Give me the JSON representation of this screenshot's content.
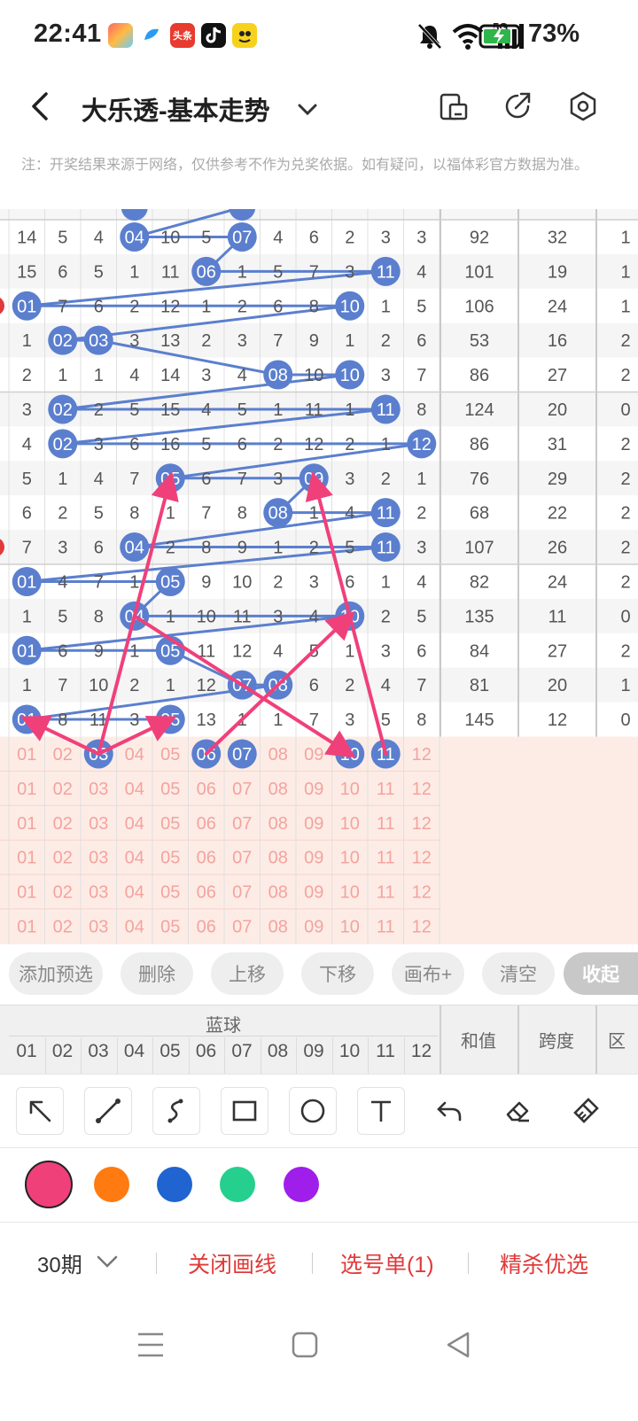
{
  "status_bar": {
    "time": "22:41",
    "battery": "73%",
    "network": "5G",
    "app_icons": [
      "photos-app-icon",
      "browser-app-icon",
      "toutiao-app-icon",
      "tiktok-app-icon",
      "game-app-icon"
    ],
    "toutiao_label": "头条",
    "status_icons": [
      "mute-icon",
      "wifi-icon",
      "signal-icon",
      "battery-icon"
    ]
  },
  "header": {
    "title": "大乐透-基本走势",
    "icons": [
      "back-icon",
      "chevron-down-icon",
      "device-icon",
      "share-icon",
      "settings-icon"
    ]
  },
  "notice": "注：开奖结果来源于网络，仅供参考不作为兑奖依据。如有疑问，以福体彩官方数据为准。",
  "colors": {
    "ball_blue": "#5b7fce",
    "line_blue": "#5b7fce",
    "arrow_pink": "#f0407a",
    "pick_bg": "#fdece6",
    "pick_text": "#f4a39e",
    "alert_red": "#e03a3a"
  },
  "chart": {
    "rows": [
      {
        "omit": [
          "14",
          "5",
          "4",
          null,
          "10",
          "5",
          null,
          "4",
          "6",
          "2",
          "3",
          "3"
        ],
        "balls": [
          3,
          6
        ],
        "sum": "92",
        "span": "32",
        "zone": "1"
      },
      {
        "omit": [
          "15",
          "6",
          "5",
          "1",
          "11",
          null,
          "1",
          "5",
          "7",
          "3",
          null,
          "4"
        ],
        "balls": [
          5,
          10
        ],
        "sum": "101",
        "span": "19",
        "zone": "1"
      },
      {
        "omit": [
          null,
          "7",
          "6",
          "2",
          "12",
          "1",
          "2",
          "6",
          "8",
          null,
          "1",
          "5"
        ],
        "balls": [
          0,
          9
        ],
        "sum": "106",
        "span": "24",
        "zone": "1"
      },
      {
        "omit": [
          "1",
          null,
          null,
          "3",
          "13",
          "2",
          "3",
          "7",
          "9",
          "1",
          "2",
          "6"
        ],
        "balls": [
          1,
          2
        ],
        "sum": "53",
        "span": "16",
        "zone": "2"
      },
      {
        "omit": [
          "2",
          "1",
          "1",
          "4",
          "14",
          "3",
          "4",
          null,
          "10",
          null,
          "3",
          "7"
        ],
        "balls": [
          7,
          9
        ],
        "sum": "86",
        "span": "27",
        "zone": "2"
      },
      {
        "omit": [
          "3",
          null,
          "2",
          "5",
          "15",
          "4",
          "5",
          "1",
          "11",
          "1",
          null,
          "8"
        ],
        "balls": [
          1,
          10
        ],
        "sum": "124",
        "span": "20",
        "zone": "0"
      },
      {
        "omit": [
          "4",
          null,
          "3",
          "6",
          "16",
          "5",
          "6",
          "2",
          "12",
          "2",
          "1",
          null
        ],
        "balls": [
          1,
          11
        ],
        "sum": "86",
        "span": "31",
        "zone": "2"
      },
      {
        "omit": [
          "5",
          "1",
          "4",
          "7",
          null,
          "6",
          "7",
          "3",
          null,
          "3",
          "2",
          "1"
        ],
        "balls": [
          4,
          8
        ],
        "sum": "76",
        "span": "29",
        "zone": "2"
      },
      {
        "omit": [
          "6",
          "2",
          "5",
          "8",
          "1",
          "7",
          "8",
          null,
          "1",
          "4",
          null,
          "2"
        ],
        "balls": [
          7,
          10
        ],
        "sum": "68",
        "span": "22",
        "zone": "2"
      },
      {
        "omit": [
          "7",
          "3",
          "6",
          null,
          "2",
          "8",
          "9",
          "1",
          "2",
          "5",
          null,
          "3"
        ],
        "balls": [
          3,
          10
        ],
        "sum": "107",
        "span": "26",
        "zone": "2"
      },
      {
        "omit": [
          null,
          "4",
          "7",
          "1",
          null,
          "9",
          "10",
          "2",
          "3",
          "6",
          "1",
          "4"
        ],
        "balls": [
          0,
          4
        ],
        "sum": "82",
        "span": "24",
        "zone": "2"
      },
      {
        "omit": [
          "1",
          "5",
          "8",
          null,
          "1",
          "10",
          "11",
          "3",
          "4",
          null,
          "2",
          "5"
        ],
        "balls": [
          3,
          9
        ],
        "sum": "135",
        "span": "11",
        "zone": "0"
      },
      {
        "omit": [
          null,
          "6",
          "9",
          "1",
          null,
          "11",
          "12",
          "4",
          "5",
          "1",
          "3",
          "6"
        ],
        "balls": [
          0,
          4
        ],
        "sum": "84",
        "span": "27",
        "zone": "2"
      },
      {
        "omit": [
          "1",
          "7",
          "10",
          "2",
          "1",
          "12",
          null,
          null,
          "6",
          "2",
          "4",
          "7"
        ],
        "balls": [
          6,
          7
        ],
        "sum": "81",
        "span": "20",
        "zone": "1"
      },
      {
        "omit": [
          null,
          "8",
          "11",
          "3",
          null,
          "13",
          "1",
          "1",
          "7",
          "3",
          "5",
          "8"
        ],
        "balls": [
          0,
          4
        ],
        "sum": "145",
        "span": "12",
        "zone": "0"
      }
    ],
    "labels": [
      "01",
      "02",
      "03",
      "04",
      "05",
      "06",
      "07",
      "08",
      "09",
      "10",
      "11",
      "12"
    ],
    "pick_row_selected": [
      2,
      5,
      6,
      9,
      10
    ],
    "pick_rows": 6
  },
  "actions": {
    "buttons": [
      "添加预选",
      "删除",
      "上移",
      "下移",
      "画布+",
      "清空",
      "收起"
    ]
  },
  "table_header": {
    "group": "蓝球",
    "sum": "和值",
    "span": "跨度",
    "zone": "区",
    "columns": [
      "01",
      "02",
      "03",
      "04",
      "05",
      "06",
      "07",
      "08",
      "09",
      "10",
      "11",
      "12"
    ]
  },
  "tools": [
    "arrow-tool-icon",
    "line-tool-icon",
    "curve-tool-icon",
    "rectangle-tool-icon",
    "circle-tool-icon",
    "text-tool-icon",
    "undo-icon",
    "eraser-icon",
    "clear-brush-icon"
  ],
  "palette": [
    "#f0407a",
    "#ff7a10",
    "#1f64d0",
    "#25cf8e",
    "#9f1eea"
  ],
  "bottom_bar": {
    "period": "30期",
    "close_lines": "关闭画线",
    "pick_list": "选号单(1)",
    "premium": "精杀优选"
  }
}
